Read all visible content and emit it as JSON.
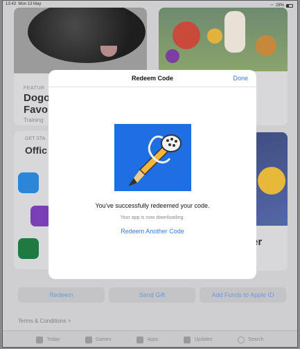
{
  "status_bar": {
    "time": "13:43",
    "date": "Mon 13 May",
    "battery": "28%"
  },
  "cards": {
    "featured": {
      "tag": "FEATUR",
      "title": "Dogo Favo",
      "sub": "Training"
    },
    "get_started": {
      "tag": "GET STA",
      "title": "Offic"
    },
    "game_title": "er"
  },
  "bottom_buttons": {
    "redeem": "Redeem",
    "send_gift": "Send Gift",
    "add_funds": "Add Funds to Apple ID"
  },
  "terms": "Terms & Conditions >",
  "tabs": [
    "Today",
    "Games",
    "Apps",
    "Updates",
    "Search"
  ],
  "modal": {
    "title": "Redeem Code",
    "done": "Done",
    "success": "You've successfully redeemed your code.",
    "downloading": "Your app is now downloading.",
    "redeem_another": "Redeem Another Code"
  },
  "colors": {
    "accent": "#2f7bea",
    "app_icon_bg": "#1e6fe3"
  },
  "icons": [
    "wifi-icon",
    "battery-icon",
    "today-icon",
    "games-icon",
    "apps-icon",
    "updates-icon",
    "search-icon",
    "notability-app-icon"
  ]
}
